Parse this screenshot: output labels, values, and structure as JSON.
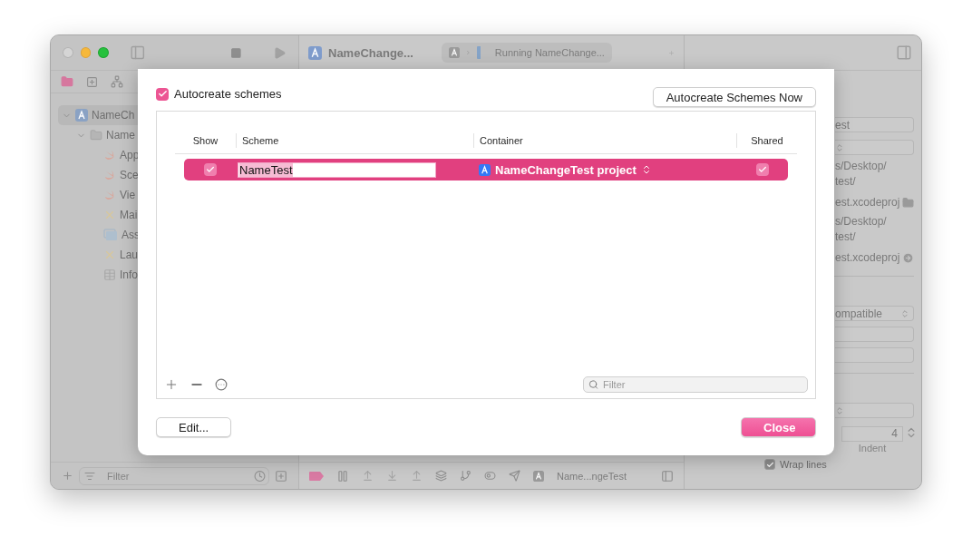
{
  "toolbar": {
    "project_title": "NameChange...",
    "activity": "Running NameChange..."
  },
  "navigator": {
    "tree": [
      {
        "label": "NameCh",
        "kind": "project",
        "expanded": true,
        "selected": true,
        "children": [
          {
            "label": "Name",
            "kind": "folder",
            "expanded": true,
            "selected": false,
            "children": [
              {
                "label": "App",
                "kind": "swift",
                "selected": false
              },
              {
                "label": "Sce",
                "kind": "swift",
                "selected": false
              },
              {
                "label": "Vie",
                "kind": "swift",
                "selected": false
              },
              {
                "label": "Mai",
                "kind": "storyboard",
                "selected": false
              },
              {
                "label": "Ass",
                "kind": "assets",
                "selected": false
              },
              {
                "label": "Lau",
                "kind": "storyboard",
                "selected": false
              },
              {
                "label": "Info",
                "kind": "plist",
                "selected": false
              }
            ]
          }
        ]
      }
    ],
    "filter": {
      "placeholder": "Filter"
    }
  },
  "debug_bar": {
    "target": "Name...ngeTest"
  },
  "inspector": {
    "rows": [
      {
        "kind": "field",
        "value": "est"
      },
      {
        "kind": "popup"
      },
      {
        "kind": "text",
        "value": "s/Desktop/"
      },
      {
        "kind": "text",
        "value": "test/"
      },
      {
        "kind": "file",
        "value": "est.xcodeproj"
      },
      {
        "kind": "text",
        "value": "s/Desktop/"
      },
      {
        "kind": "text",
        "value": "test/"
      },
      {
        "kind": "reference",
        "value": "est.xcodeproj"
      },
      {
        "kind": "divider"
      },
      {
        "kind": "popup",
        "value": "ompatible"
      },
      {
        "kind": "field"
      },
      {
        "kind": "field"
      },
      {
        "kind": "divider"
      },
      {
        "kind": "popup"
      },
      {
        "kind": "stepper",
        "value": "4",
        "label": "Indent"
      },
      {
        "kind": "checkbox",
        "label": "Wrap lines",
        "checked": true
      }
    ]
  },
  "sheet": {
    "autocreate": {
      "label": "Autocreate schemes",
      "checked": true
    },
    "autocreate_now_button": "Autocreate Schemes Now",
    "columns": [
      "Show",
      "Scheme",
      "Container",
      "Shared"
    ],
    "rows": [
      {
        "show": true,
        "scheme": "NameTest",
        "container": "NameChangeTest project",
        "shared": true,
        "selected": true
      }
    ],
    "filter": {
      "placeholder": "Filter"
    },
    "edit_button": "Edit...",
    "close_button": "Close"
  }
}
